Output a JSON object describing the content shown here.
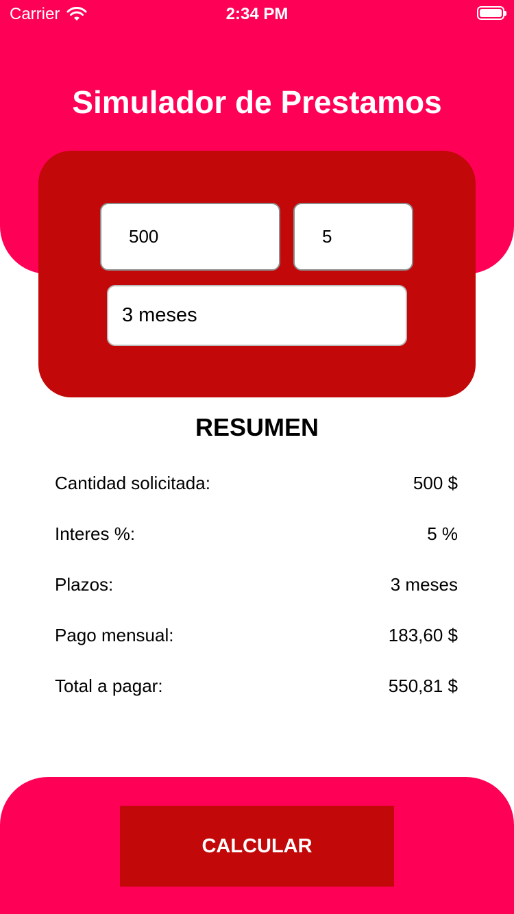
{
  "status_bar": {
    "carrier": "Carrier",
    "time": "2:34 PM"
  },
  "header": {
    "title": "Simulador de Prestamos"
  },
  "form": {
    "amount_value": "500",
    "interest_value": "5",
    "term_value": "3 meses"
  },
  "summary": {
    "title": "RESUMEN",
    "rows": [
      {
        "label": "Cantidad solicitada:",
        "value": "500 $"
      },
      {
        "label": "Interes %:",
        "value": "5 %"
      },
      {
        "label": "Plazos:",
        "value": "3 meses"
      },
      {
        "label": "Pago mensual:",
        "value": "183,60 $"
      },
      {
        "label": "Total a pagar:",
        "value": "550,81 $"
      }
    ]
  },
  "footer": {
    "calculate_label": "CALCULAR"
  },
  "colors": {
    "primary": "#ff0057",
    "card": "#c20808",
    "text": "#000000",
    "on_primary": "#ffffff"
  },
  "icons": [
    "wifi-icon",
    "battery-icon"
  ]
}
